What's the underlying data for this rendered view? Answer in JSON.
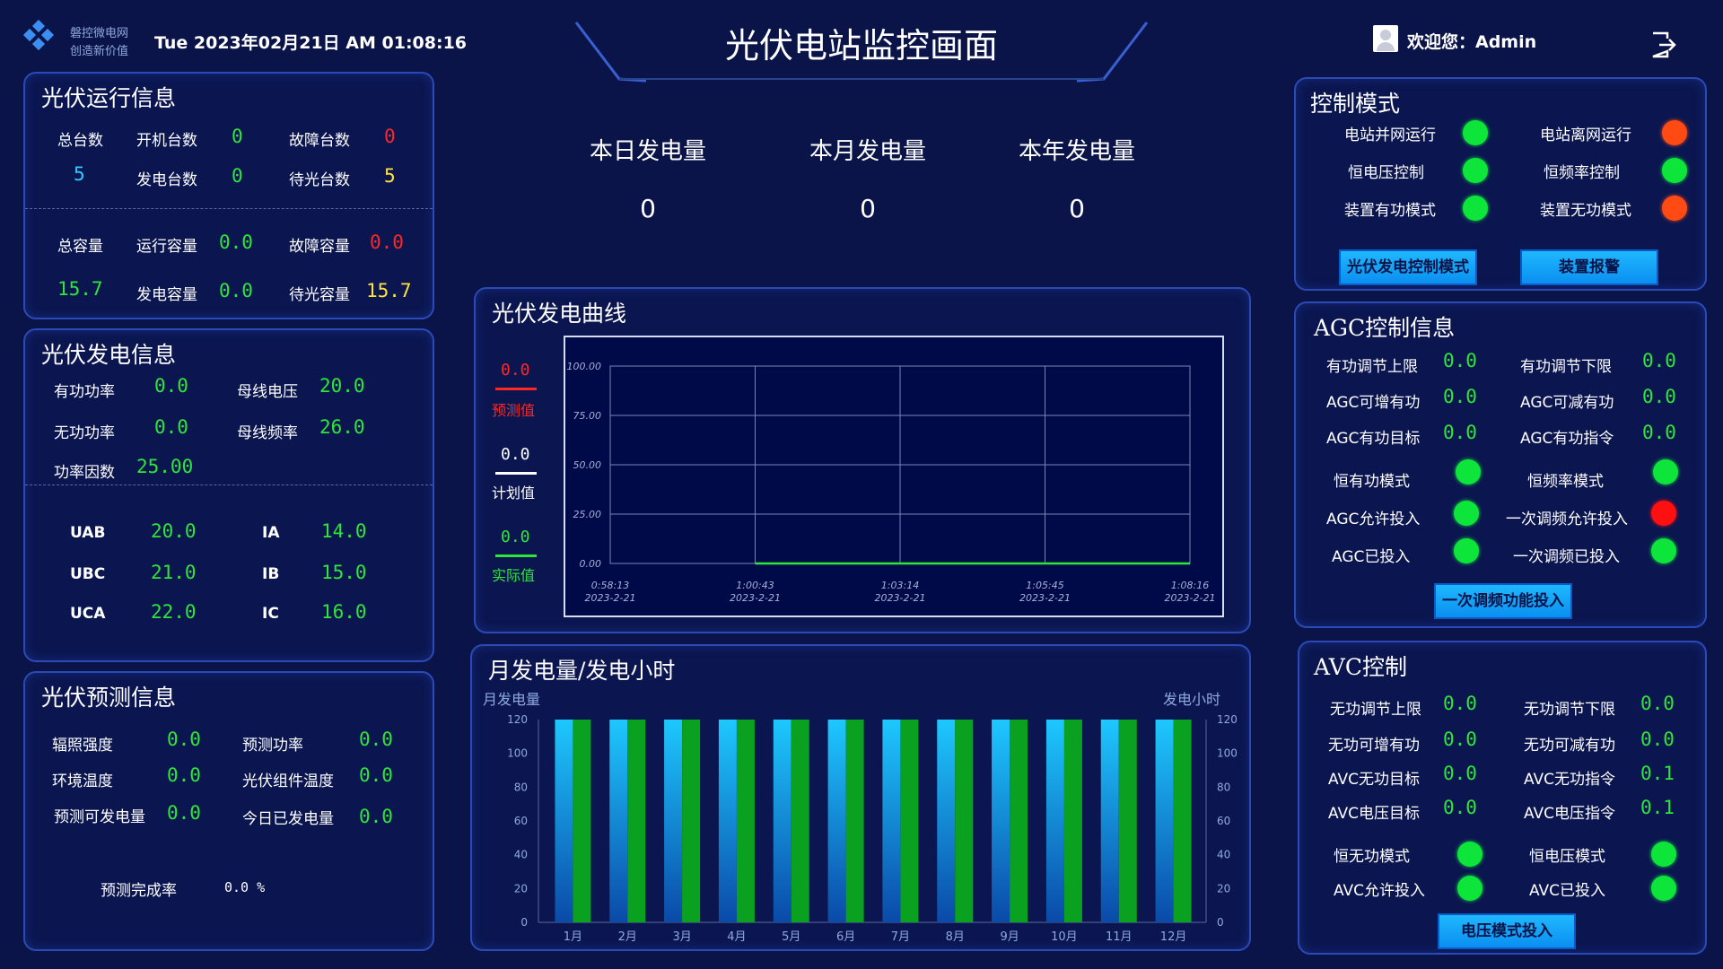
{
  "header": {
    "logo_line1": "磐控微电网",
    "logo_line2": "创造新价值",
    "datetime": "Tue 2023年02月21日 AM 01:08:16",
    "title": "光伏电站监控画面",
    "welcome": "欢迎您：Admin"
  },
  "run_info": {
    "title": "光伏运行信息",
    "total_units_label": "总台数",
    "total_units": "5",
    "on_units_label": "开机台数",
    "on_units": "0",
    "gen_units_label": "发电台数",
    "gen_units": "0",
    "fault_units_label": "故障台数",
    "fault_units": "0",
    "wait_units_label": "待光台数",
    "wait_units": "5",
    "total_cap_label": "总容量",
    "total_cap": "15.7",
    "run_cap_label": "运行容量",
    "run_cap": "0.0",
    "gen_cap_label": "发电容量",
    "gen_cap": "0.0",
    "fault_cap_label": "故障容量",
    "fault_cap": "0.0",
    "wait_cap_label": "待光容量",
    "wait_cap": "15.7"
  },
  "gen_info": {
    "title": "光伏发电信息",
    "p_label": "有功功率",
    "p": "0.0",
    "bus_v_label": "母线电压",
    "bus_v": "20.0",
    "q_label": "无功功率",
    "q": "0.0",
    "bus_f_label": "母线频率",
    "bus_f": "26.0",
    "pf_label": "功率因数",
    "pf": "25.00",
    "uab_label": "UAB",
    "uab": "20.0",
    "ubc_label": "UBC",
    "ubc": "21.0",
    "uca_label": "UCA",
    "uca": "22.0",
    "ia_label": "IA",
    "ia": "14.0",
    "ib_label": "IB",
    "ib": "15.0",
    "ic_label": "IC",
    "ic": "16.0"
  },
  "forecast": {
    "title": "光伏预测信息",
    "irr_label": "辐照强度",
    "irr": "0.0",
    "fp_label": "预测功率",
    "fp": "0.0",
    "temp_label": "环境温度",
    "temp": "0.0",
    "modtemp_label": "光伏组件温度",
    "modtemp": "0.0",
    "fe_label": "预测可发电量",
    "fe": "0.0",
    "te_label": "今日已发电量",
    "te": "0.0",
    "rate_label": "预测完成率",
    "rate": "0.0 %"
  },
  "kpis": {
    "day_label": "本日发电量",
    "day": "0",
    "month_label": "本月发电量",
    "month": "0",
    "year_label": "本年发电量",
    "year": "0"
  },
  "curve": {
    "title": "光伏发电曲线",
    "pred_value": "0.0",
    "pred_label": "预测值",
    "plan_value": "0.0",
    "plan_label": "计划值",
    "actual_value": "0.0",
    "actual_label": "实际值"
  },
  "monthly": {
    "title": "月发电量/发电小时",
    "left_axis": "月发电量",
    "right_axis": "发电小时"
  },
  "control_mode": {
    "title": "控制模式",
    "grid_label": "电站并网运行",
    "island_label": "电站离网运行",
    "voltage_label": "恒电压控制",
    "freq_label": "恒频率控制",
    "active_label": "装置有功模式",
    "reactive_label": "装置无功模式",
    "btn_pv_mode": "光伏发电控制模式",
    "btn_alarm": "装置报警"
  },
  "agc": {
    "title": "AGC控制信息",
    "up_label": "有功调节上限",
    "up": "0.0",
    "down_label": "有功调节下限",
    "down": "0.0",
    "inc_label": "AGC可增有功",
    "inc": "0.0",
    "dec_label": "AGC可减有功",
    "dec": "0.0",
    "target_label": "AGC有功目标",
    "target": "0.0",
    "cmd_label": "AGC有功指令",
    "cmd": "0.0",
    "const_p_label": "恒有功模式",
    "const_f_label": "恒频率模式",
    "allow_label": "AGC允许投入",
    "pfr_allow_label": "一次调频允许投入",
    "on_label": "AGC已投入",
    "pfr_on_label": "一次调频已投入",
    "btn": "一次调频功能投入"
  },
  "avc": {
    "title": "AVC控制",
    "up_label": "无功调节上限",
    "up": "0.0",
    "down_label": "无功调节下限",
    "down": "0.0",
    "inc_label": "无功可增有功",
    "inc": "0.0",
    "dec_label": "无功可减有功",
    "dec": "0.0",
    "qtarget_label": "AVC无功目标",
    "qtarget": "0.0",
    "qcmd_label": "AVC无功指令",
    "qcmd": "0.1",
    "vtarget_label": "AVC电压目标",
    "vtarget": "0.0",
    "vcmd_label": "AVC电压指令",
    "vcmd": "0.1",
    "const_q_label": "恒无功模式",
    "const_v_label": "恒电压模式",
    "allow_label": "AVC允许投入",
    "on_label": "AVC已投入",
    "btn": "电压模式投入"
  },
  "colors": {
    "background": "#0a1448",
    "panel_border": "#2b4ab8",
    "green": "#2ee63a",
    "red": "#ff2626",
    "yellow": "#ffe53b",
    "cyan": "#38c8ff",
    "orange": "#ff4a14"
  },
  "chart_data": [
    {
      "type": "line",
      "title": "光伏发电曲线",
      "x": [
        "0:58:13 2023-2-21",
        "1:00:43 2023-2-21",
        "1:03:14 2023-2-21",
        "1:05:45 2023-2-21",
        "1:08:16 2023-2-21"
      ],
      "ylim": [
        0,
        100
      ],
      "yticks": [
        "0.00",
        "25.00",
        "50.00",
        "75.00",
        "100.00"
      ],
      "xticks": [
        {
          "time": "0:58:13",
          "date": "2023-2-21"
        },
        {
          "time": "1:00:43",
          "date": "2023-2-21"
        },
        {
          "time": "1:03:14",
          "date": "2023-2-21"
        },
        {
          "time": "1:05:45",
          "date": "2023-2-21"
        },
        {
          "time": "1:08:16",
          "date": "2023-2-21"
        }
      ],
      "series": [
        {
          "name": "实际值",
          "color": "#2ee63a",
          "x_range": [
            "1:00:43",
            "1:08:16"
          ],
          "values": [
            0,
            0,
            0,
            0
          ]
        }
      ],
      "grid": true
    },
    {
      "type": "bar",
      "title": "月发电量/发电小时",
      "categories": [
        "1月",
        "2月",
        "3月",
        "4月",
        "5月",
        "6月",
        "7月",
        "8月",
        "9月",
        "10月",
        "11月",
        "12月"
      ],
      "ylabel": "月发电量",
      "y2label": "发电小时",
      "ylim": [
        0,
        120
      ],
      "y2lim": [
        0,
        120
      ],
      "yticks": [
        0,
        20,
        40,
        60,
        80,
        100,
        120
      ],
      "series": [
        {
          "color": "#1ab0f0",
          "values": [
            120,
            120,
            120,
            120,
            120,
            120,
            120,
            120,
            120,
            120,
            120,
            120
          ]
        },
        {
          "color": "#0aa020",
          "values": [
            120,
            120,
            120,
            120,
            120,
            120,
            120,
            120,
            120,
            120,
            120,
            120
          ]
        }
      ]
    }
  ]
}
